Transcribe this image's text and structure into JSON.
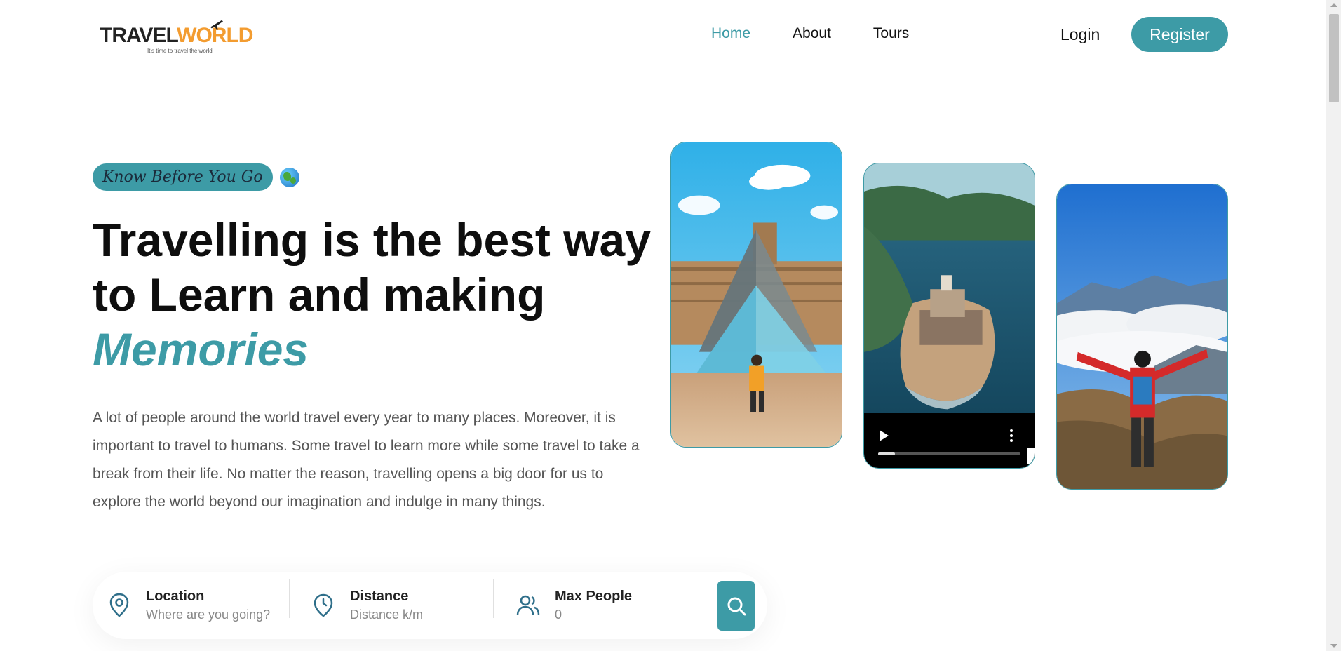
{
  "brand": {
    "name_part1": "TRAVEL",
    "name_part2": "WORLD",
    "tagline": "It's time to travel the world"
  },
  "nav": {
    "items": [
      {
        "label": "Home",
        "active": true
      },
      {
        "label": "About",
        "active": false
      },
      {
        "label": "Tours",
        "active": false
      }
    ],
    "login_label": "Login",
    "register_label": "Register"
  },
  "hero": {
    "subtitle": "Know Before You Go",
    "title_line1": "Travelling is the best way",
    "title_line2": "to Learn and making",
    "title_accent": "Memories",
    "description": "A lot of people around the world travel every year to many places. Moreover, it is important to travel to humans. Some travel to learn more while some travel to take a break from their life. No matter the reason, travelling opens a big door for us to explore the world beyond our imagination and indulge in many things.",
    "video_progress_fraction": 0.12
  },
  "search": {
    "location": {
      "label": "Location",
      "placeholder": "Where are you going?"
    },
    "distance": {
      "label": "Distance",
      "placeholder": "Distance k/m"
    },
    "people": {
      "label": "Max People",
      "placeholder": "0"
    }
  },
  "colors": {
    "accent": "#3d9ba6",
    "logo_orange": "#f39c30",
    "text_dark": "#111111",
    "text_muted": "#555555"
  },
  "icons": [
    "plane-icon",
    "globe-icon",
    "play-icon",
    "volume-icon",
    "more-vertical-icon",
    "map-pin-icon",
    "clock-icon",
    "users-icon",
    "search-icon"
  ]
}
